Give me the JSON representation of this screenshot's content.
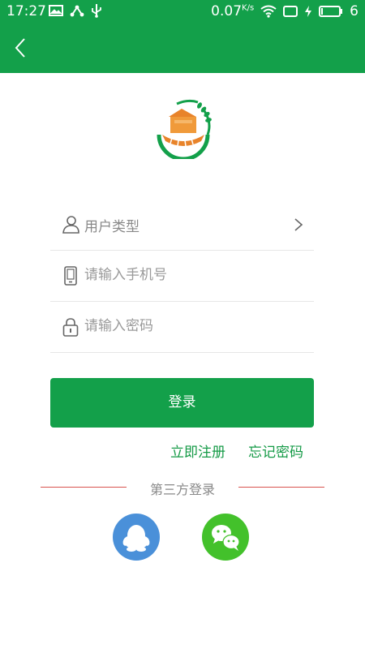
{
  "status_bar": {
    "time": "17:27",
    "speed": "0.07",
    "speed_unit": "K/s",
    "battery": "6"
  },
  "header": {
    "back_icon": "chevron-left-icon"
  },
  "form": {
    "user_type_label": "用户类型",
    "phone_placeholder": "请输入手机号",
    "password_placeholder": "请输入密码"
  },
  "actions": {
    "login_label": "登录",
    "register_label": "立即注册",
    "forgot_label": "忘记密码"
  },
  "third_party": {
    "label": "第三方登录",
    "qq_icon": "qq-icon",
    "wechat_icon": "wechat-icon"
  },
  "colors": {
    "brand_green": "#13a04a",
    "divider_red": "#d9534f",
    "qq_blue": "#4a90d9",
    "wechat_green": "#43c12b"
  }
}
